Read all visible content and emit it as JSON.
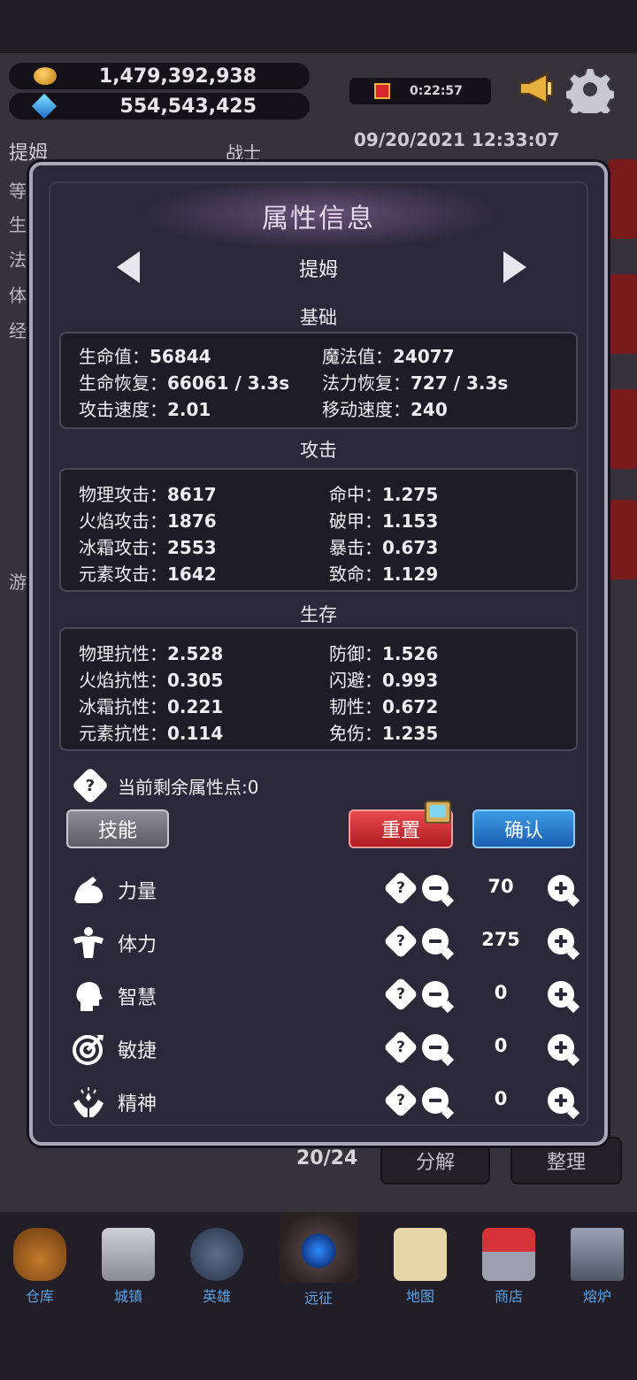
{
  "top": {
    "gold": "1,479,392,938",
    "gems": "554,543,425",
    "timer": "0:22:57",
    "datetime": "09/20/2021 12:33:07"
  },
  "background": {
    "hero_name": "提姆",
    "hero_class": "战士",
    "side_labels": [
      "等",
      "生",
      "法",
      "体",
      "经",
      "游"
    ],
    "inventory_count": "20/24",
    "decompose_label": "分解",
    "sort_label": "整理"
  },
  "modal": {
    "title": "属性信息",
    "hero_name": "提姆",
    "sections": {
      "basic": {
        "title": "基础",
        "rows": [
          {
            "label": "生命值：",
            "value": "56844"
          },
          {
            "label": "魔法值：",
            "value": "24077"
          },
          {
            "label": "生命恢复：",
            "value": "66061 / 3.3s"
          },
          {
            "label": "法力恢复：",
            "value": "727 / 3.3s"
          },
          {
            "label": "攻击速度：",
            "value": "2.01"
          },
          {
            "label": "移动速度：",
            "value": "240"
          }
        ]
      },
      "attack": {
        "title": "攻击",
        "rows": [
          {
            "label": "物理攻击：",
            "value": "8617"
          },
          {
            "label": "命中：",
            "value": "1.275"
          },
          {
            "label": "火焰攻击：",
            "value": "1876"
          },
          {
            "label": "破甲：",
            "value": "1.153"
          },
          {
            "label": "冰霜攻击：",
            "value": "2553"
          },
          {
            "label": "暴击：",
            "value": "0.673"
          },
          {
            "label": "元素攻击：",
            "value": "1642"
          },
          {
            "label": "致命：",
            "value": "1.129"
          }
        ]
      },
      "survival": {
        "title": "生存",
        "rows": [
          {
            "label": "物理抗性：",
            "value": "2.528"
          },
          {
            "label": "防御：",
            "value": "1.526"
          },
          {
            "label": "火焰抗性：",
            "value": "0.305"
          },
          {
            "label": "闪避：",
            "value": "0.993"
          },
          {
            "label": "冰霜抗性：",
            "value": "0.221"
          },
          {
            "label": "韧性：",
            "value": "0.672"
          },
          {
            "label": "元素抗性：",
            "value": "0.114"
          },
          {
            "label": "免伤：",
            "value": "1.235"
          }
        ]
      }
    },
    "points_label": "当前剩余属性点:0",
    "help_glyph": "?",
    "buttons": {
      "skill": "技能",
      "reset": "重置",
      "confirm": "确认"
    },
    "attributes": [
      {
        "name": "力量",
        "value": "70",
        "icon": "strength-icon"
      },
      {
        "name": "体力",
        "value": "275",
        "icon": "stamina-icon"
      },
      {
        "name": "智慧",
        "value": "0",
        "icon": "wisdom-icon"
      },
      {
        "name": "敏捷",
        "value": "0",
        "icon": "agility-icon"
      },
      {
        "name": "精神",
        "value": "0",
        "icon": "spirit-icon"
      }
    ]
  },
  "nav": [
    {
      "label": "仓库",
      "icon": "bag-icon"
    },
    {
      "label": "城镇",
      "icon": "castle-icon"
    },
    {
      "label": "英雄",
      "icon": "helmet-icon"
    },
    {
      "label": "远征",
      "icon": "portal-icon"
    },
    {
      "label": "地图",
      "icon": "map-icon"
    },
    {
      "label": "商店",
      "icon": "shop-icon"
    },
    {
      "label": "熔炉",
      "icon": "anvil-icon"
    }
  ]
}
